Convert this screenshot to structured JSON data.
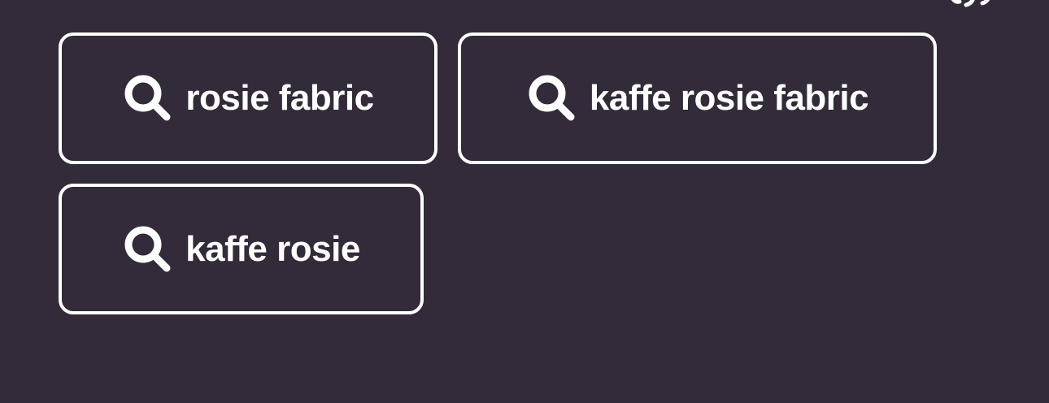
{
  "suggestions": [
    {
      "label": "rosie fabric",
      "icon": "search-icon"
    },
    {
      "label": "kaffe rosie fabric",
      "icon": "search-icon"
    },
    {
      "label": "kaffe rosie",
      "icon": "search-icon"
    }
  ],
  "colors": {
    "background": "#332b39",
    "foreground": "#ffffff"
  }
}
